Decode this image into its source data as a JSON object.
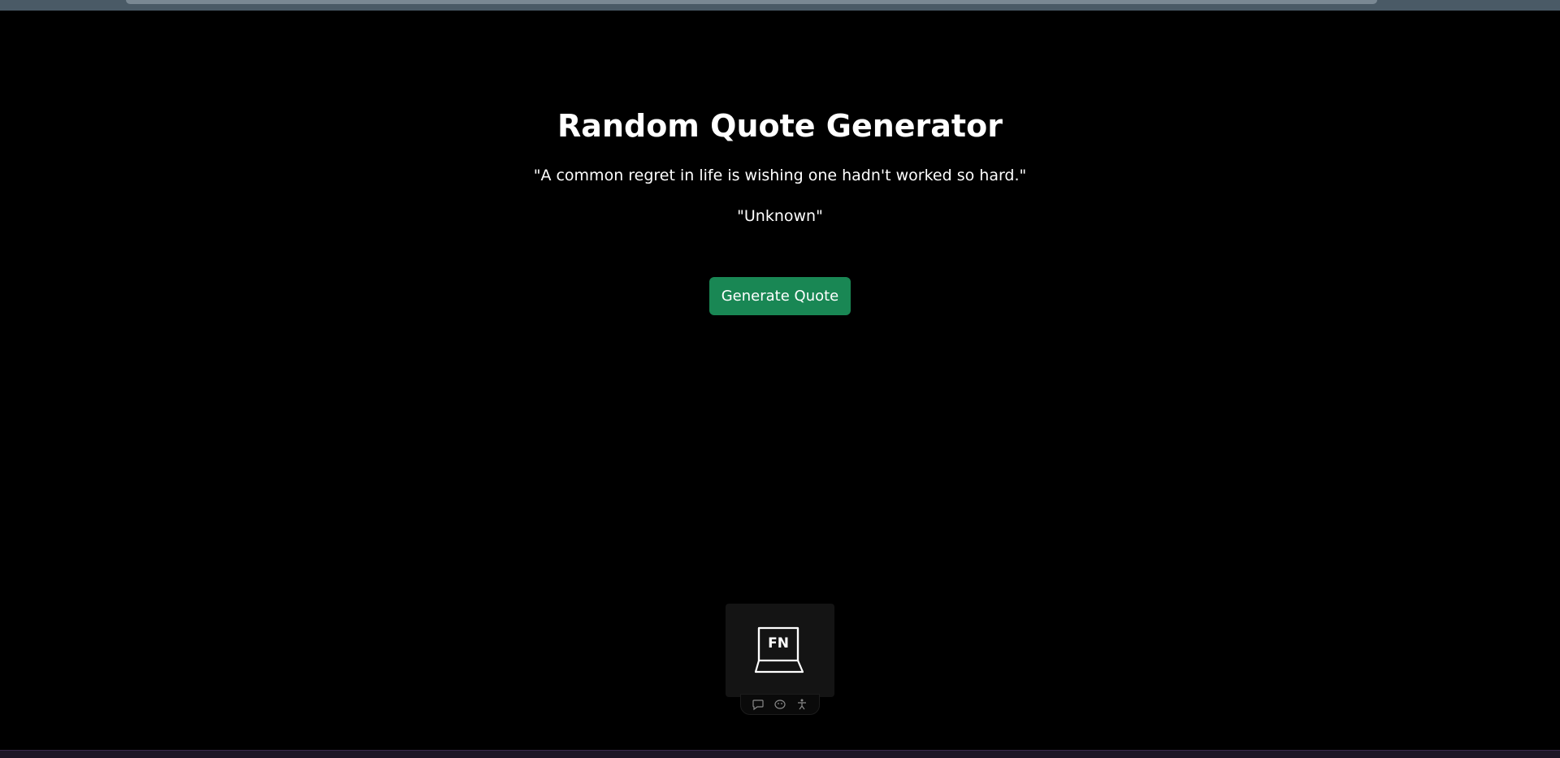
{
  "page": {
    "title": "Random Quote Generator",
    "quote": "\"A common regret in life is wishing one hadn't worked so hard.\"",
    "author": "\"Unknown\"",
    "generate_button_label": "Generate Quote"
  },
  "widget": {
    "key_label": "FN",
    "icons": [
      "chat-bubble-icon",
      "emoji-icon",
      "accessibility-icon"
    ]
  },
  "colors": {
    "background": "#000000",
    "text": "#ffffff",
    "button": "#198754",
    "widget_bg": "#141414"
  }
}
